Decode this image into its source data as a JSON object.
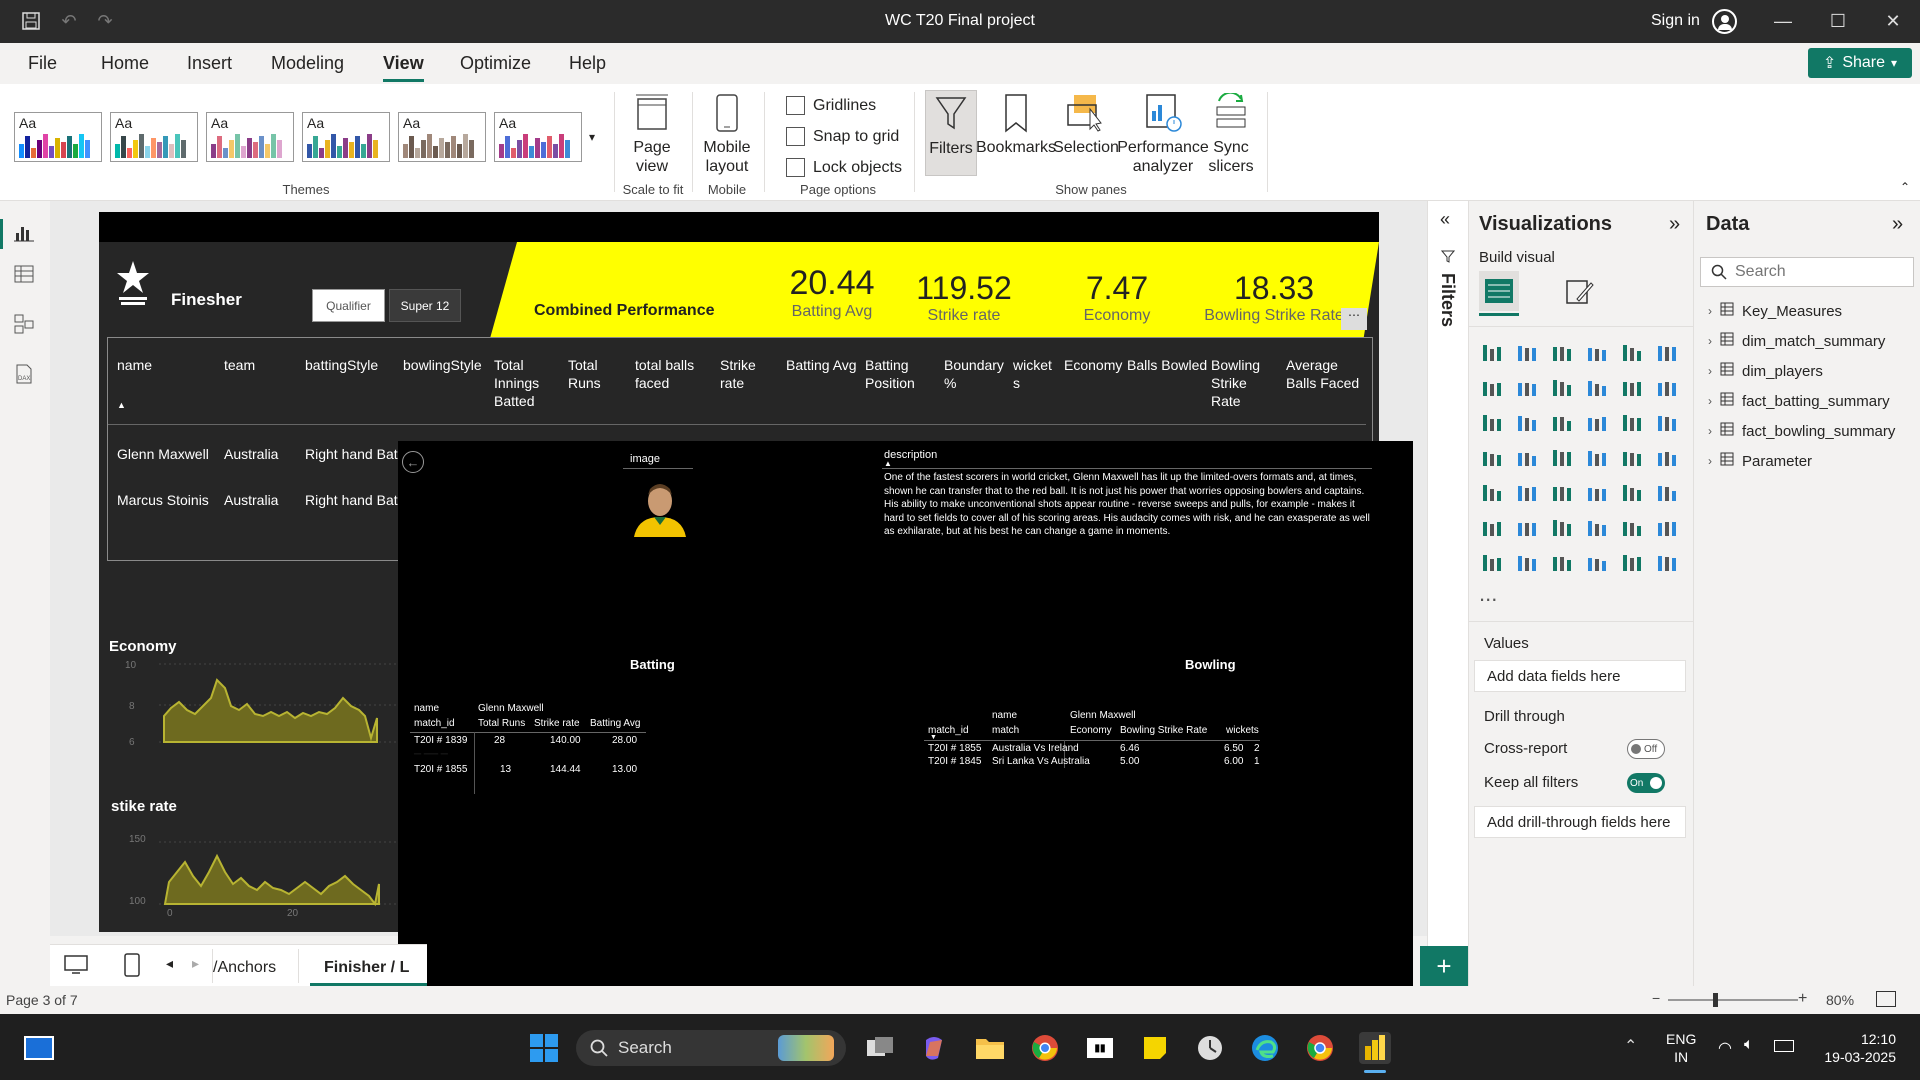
{
  "window": {
    "title": "WC T20 Final project",
    "signin": "Sign in"
  },
  "menu": [
    "File",
    "Home",
    "Insert",
    "Modeling",
    "View",
    "Optimize",
    "Help"
  ],
  "share_label": "Share",
  "ribbon": {
    "themes_label": "Themes",
    "theme_sample": "Aa",
    "page_view": "Page view",
    "scale_label": "Scale to fit",
    "mobile_layout": "Mobile layout",
    "mobile_label": "Mobile",
    "gridlines": "Gridlines",
    "snap": "Snap to grid",
    "lock": "Lock objects",
    "page_options_label": "Page options",
    "filters": "Filters",
    "bookmarks": "Bookmarks",
    "selection": "Selection",
    "perf": "Performance analyzer",
    "sync": "Sync slicers",
    "show_panes_label": "Show panes"
  },
  "report": {
    "title": "Finesher",
    "btn_qualifier": "Qualifier",
    "btn_super12": "Super 12",
    "combined": "Combined Performance",
    "kpis": [
      {
        "value": "20.44",
        "label": "Batting Avg"
      },
      {
        "value": "119.52",
        "label": "Strike rate"
      },
      {
        "value": "7.47",
        "label": "Economy"
      },
      {
        "value": "18.33",
        "label": "Bowling Strike Rate"
      }
    ],
    "table_headers": [
      "name",
      "team",
      "battingStyle",
      "bowlingStyle",
      "Total Innings Batted",
      "Total Runs",
      "total balls faced",
      "Strike rate",
      "Batting Avg",
      "Batting Position",
      "Boundary %",
      "wicket s",
      "Economy",
      "Balls Bowled",
      "Bowling Strike Rate",
      "Average Balls Faced"
    ],
    "rows": [
      {
        "name": "Glenn Maxwell",
        "team": "Australia",
        "bat": "Right hand Bat"
      },
      {
        "name": "Marcus Stoinis",
        "team": "Australia",
        "bat": "Right hand Bat"
      }
    ],
    "economy_title": "Economy",
    "economy_yticks": [
      "10",
      "8",
      "6"
    ],
    "sr_title": "stike rate",
    "sr_yticks": [
      "150",
      "100"
    ],
    "sr_xticks": [
      "0",
      "20"
    ]
  },
  "popup": {
    "image_label": "image",
    "desc_label": "description",
    "description": "One of the fastest scorers in world cricket, Glenn Maxwell has lit up the limited-overs formats and, at times, shown he can transfer that to the red ball. It is not just his power that worries opposing bowlers and captains. His ability to make unconventional shots appear routine - reverse sweeps and pulls, for example - makes it hard to set fields to cover all of his scoring areas. His audacity comes with risk, and he can exasperate as well as exhilarate, but at his best he can change a game in moments.",
    "batting_title": "Batting",
    "bowling_title": "Bowling",
    "bat_h1": [
      "name",
      "Glenn Maxwell"
    ],
    "bat_h2": [
      "match_id",
      "Total Runs",
      "Strike rate",
      "Batting Avg"
    ],
    "bat_rows": [
      [
        "T20I # 1839",
        "28",
        "140.00",
        "28.00"
      ],
      [
        "T20I # 1855",
        "13",
        "144.44",
        "13.00"
      ]
    ],
    "bowl_h1": [
      "name",
      "Glenn Maxwell"
    ],
    "bowl_h1b": "match",
    "bowl_h2": [
      "match_id",
      "match",
      "Economy",
      "Bowling Strike Rate",
      "wickets"
    ],
    "bowl_rows": [
      [
        "T20I # 1855",
        "Australia Vs Ireland",
        "6.46",
        "6.50",
        "2"
      ],
      [
        "T20I # 1845",
        "Sri Lanka Vs Australia",
        "5.00",
        "6.00",
        "1"
      ]
    ]
  },
  "filters_label": "Filters",
  "viz": {
    "title": "Visualizations",
    "build": "Build visual",
    "values": "Values",
    "add_data": "Add data fields here",
    "drill": "Drill through",
    "cross": "Cross-report",
    "cross_state": "Off",
    "keep": "Keep all filters",
    "keep_state": "On",
    "add_drill": "Add drill-through fields here",
    "more": "..."
  },
  "data": {
    "title": "Data",
    "search_placeholder": "Search",
    "tables": [
      "Key_Measures",
      "dim_match_summary",
      "dim_players",
      "fact_batting_summary",
      "fact_bowling_summary",
      "Parameter"
    ]
  },
  "tabs": [
    "/Anchors",
    "Finisher / L"
  ],
  "status": {
    "page": "Page 3 of 7",
    "zoom": "80%"
  },
  "taskbar": {
    "search": "Search",
    "lang1": "ENG",
    "lang2": "IN",
    "time": "12:10",
    "date": "19-03-2025"
  },
  "colors": {
    "accent": "#117865",
    "kpi_band": "#ffff00",
    "area": "#6e6a1f"
  }
}
